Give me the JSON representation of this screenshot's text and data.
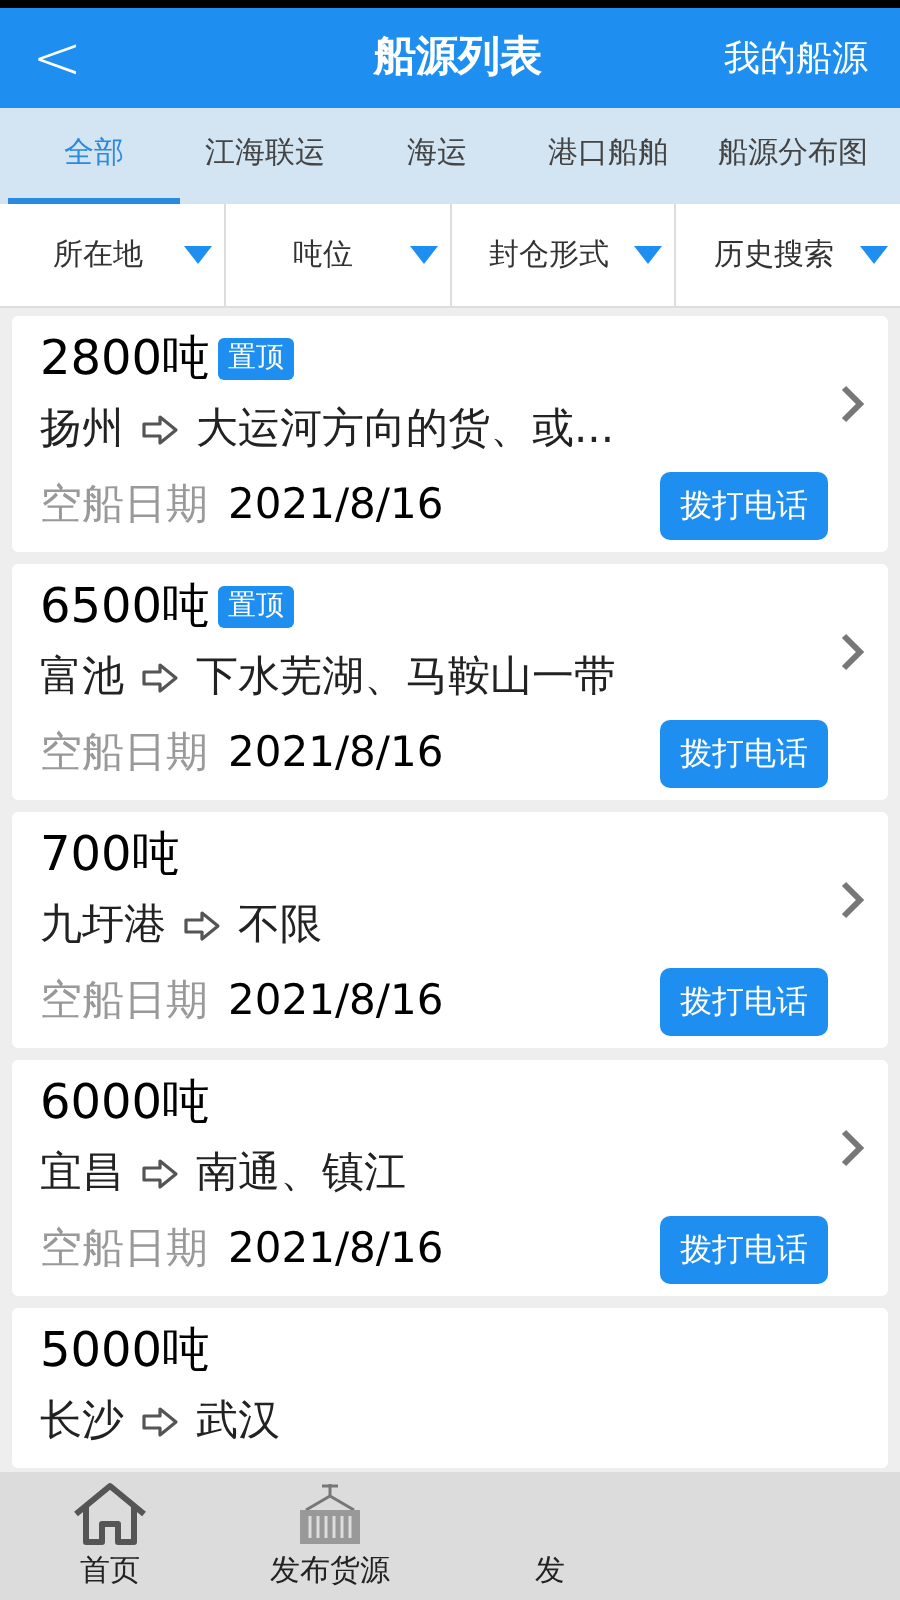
{
  "header": {
    "back": "<",
    "title": "船源列表",
    "action": "我的船源"
  },
  "tabs": [
    {
      "label": "全部",
      "selected": true
    },
    {
      "label": "江海联运",
      "selected": false
    },
    {
      "label": "海运",
      "selected": false
    },
    {
      "label": "港口船舶",
      "selected": false
    },
    {
      "label": "船源分布图",
      "selected": false
    }
  ],
  "filters": [
    "所在地",
    "吨位",
    "封仓形式",
    "历史搜索"
  ],
  "ships": [
    {
      "tonnage": "2800吨",
      "badge": "置顶",
      "from": "扬州",
      "to": "大运河方向的货、或...",
      "date_label": "空船日期",
      "date": "2021/8/16",
      "call": "拨打电话"
    },
    {
      "tonnage": "6500吨",
      "badge": "置顶",
      "from": "富池",
      "to": "下水芜湖、马鞍山一带",
      "date_label": "空船日期",
      "date": "2021/8/16",
      "call": "拨打电话"
    },
    {
      "tonnage": "700吨",
      "from": "九圩港",
      "to": "不限",
      "date_label": "空船日期",
      "date": "2021/8/16",
      "call": "拨打电话"
    },
    {
      "tonnage": "6000吨",
      "from": "宜昌",
      "to": "南通、镇江",
      "date_label": "空船日期",
      "date": "2021/8/16",
      "call": "拨打电话"
    },
    {
      "tonnage": "5000吨",
      "from": "长沙",
      "to": "武汉"
    }
  ],
  "bottom_nav": [
    {
      "kind": "home",
      "label": "首页"
    },
    {
      "kind": "container",
      "label": "发布货源"
    },
    {
      "kind": "none",
      "label": "发"
    }
  ]
}
